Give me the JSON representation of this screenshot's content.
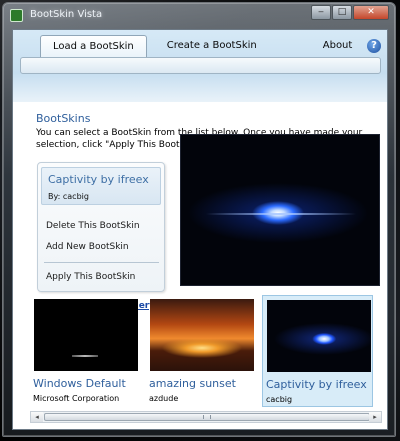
{
  "window": {
    "title": "BootSkin Vista",
    "controls": {
      "minimize": "‒",
      "maximize": "□",
      "close": "✕"
    }
  },
  "tabs": [
    {
      "label": "Load a BootSkin",
      "active": true
    },
    {
      "label": "Create a BootSkin",
      "active": false
    },
    {
      "label": "About",
      "active": false
    }
  ],
  "help": {
    "glyph": "?"
  },
  "section": {
    "title": "BootSkins",
    "description": "You can select a BootSkin from the list below.  Once you have made your selection, click \"Apply This BootSkin.\""
  },
  "selected_skin": {
    "name": "Captivity by ifreex",
    "author": "By: cacbig"
  },
  "actions": {
    "delete": "Delete This BootSkin",
    "add": "Add New BootSkin",
    "apply": "Apply This BootSkin",
    "gallery": "View BootSkin Gallery"
  },
  "thumbnails": [
    {
      "name": "Windows Default",
      "author": "Microsoft Corporation",
      "selected": false
    },
    {
      "name": "amazing sunset",
      "author": "azdude",
      "selected": false
    },
    {
      "name": "Captivity by ifreex",
      "author": "cacbig",
      "selected": true
    }
  ],
  "scrollbar": {
    "left_arrow": "◂",
    "right_arrow": "▸"
  },
  "colors": {
    "accent_text": "#2f5f9c",
    "link": "#1c4aa6",
    "header_band": "#c6def0",
    "selected_card": "#d8ecf8"
  }
}
